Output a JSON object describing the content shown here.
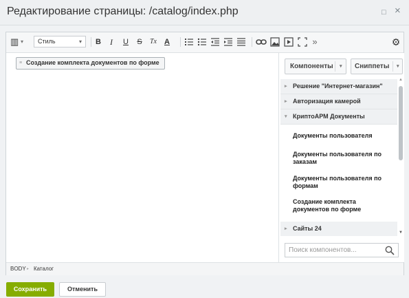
{
  "window": {
    "title": "Редактирование страницы: /catalog/index.php",
    "maximize_icon": "□",
    "close_icon": "×"
  },
  "toolbar": {
    "view_mode_icon": "▥",
    "view_mode_arrow": "▾",
    "style_select": {
      "value": "Стиль",
      "arrow": "▾"
    },
    "bold": "B",
    "italic": "I",
    "underline": "U",
    "strikethrough": "S",
    "remove_format": "Tx",
    "text_color": "A",
    "more": "»",
    "settings_icon": "⚙"
  },
  "content": {
    "component_label": "Создание комплекта документов по форме",
    "component_grip": "≡"
  },
  "panel": {
    "tabs": [
      {
        "label": "Компоненты",
        "arrow": "▾"
      },
      {
        "label": "Сниппеты",
        "arrow": "▾"
      }
    ],
    "sections": [
      {
        "label": "Решение \"Интернет-магазин\"",
        "icon": "▸"
      },
      {
        "label": "Авторизация камерой",
        "icon": "▸"
      },
      {
        "label": "КриптоАРМ Документы",
        "icon": "▾"
      },
      {
        "label": "Сайты 24",
        "icon": "▸"
      }
    ],
    "items": [
      "Документы пользователя",
      "Документы пользователя по заказам",
      "Документы пользователя по формам",
      "Создание комплекта документов по форме"
    ],
    "search": {
      "placeholder": "Поиск компонентов..."
    },
    "scroll_up": "▲",
    "scroll_down": "▼"
  },
  "statusbar": {
    "crumbs": [
      "BODY",
      "Каталог"
    ],
    "separator": "▸"
  },
  "buttons": {
    "save": "Сохранить",
    "cancel": "Отменить"
  },
  "colors": {
    "save_button": "#86ad00",
    "header_bg": "#eef0f2"
  }
}
